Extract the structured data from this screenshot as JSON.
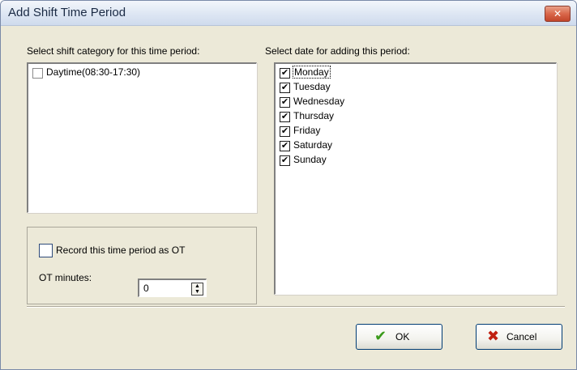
{
  "window": {
    "title": "Add Shift Time Period",
    "close_glyph": "✕"
  },
  "shift_category": {
    "label": "Select shift category for this time period:",
    "items": [
      {
        "label": "Daytime(08:30-17:30)",
        "checked": false
      }
    ]
  },
  "dates": {
    "label": "Select date for adding this period:",
    "items": [
      {
        "label": "Monday",
        "checked": true
      },
      {
        "label": "Tuesday",
        "checked": true
      },
      {
        "label": "Wednesday",
        "checked": true
      },
      {
        "label": "Thursday",
        "checked": true
      },
      {
        "label": "Friday",
        "checked": true
      },
      {
        "label": "Saturday",
        "checked": true
      },
      {
        "label": "Sunday",
        "checked": true
      }
    ],
    "check_glyph": "✔"
  },
  "ot": {
    "record_label": "Record this time period as OT",
    "record_checked": false,
    "minutes_label": "OT minutes:",
    "minutes_value": "0",
    "up_glyph": "▲",
    "down_glyph": "▼"
  },
  "buttons": {
    "ok_label": "OK",
    "ok_icon": "✔",
    "cancel_label": "Cancel",
    "cancel_icon": "✖"
  },
  "colors": {
    "ok_icon": "#3a9a1a",
    "cancel_icon": "#c02010"
  },
  "icons": {
    "ok": "checkmark-icon",
    "cancel": "x-icon",
    "close": "close-icon"
  }
}
